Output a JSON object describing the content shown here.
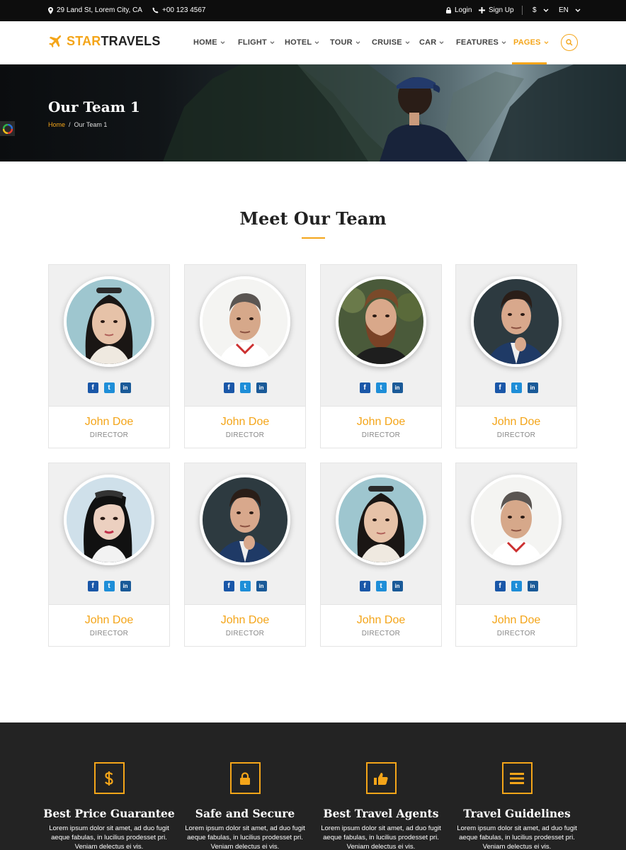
{
  "topbar": {
    "address": "29 Land St, Lorem City, CA",
    "phone": "+00 123 4567",
    "login": "Login",
    "signup": "Sign Up",
    "currency": "$",
    "language": "EN"
  },
  "brand": {
    "part1": "STAR",
    "part2": "TRAVELS",
    "accent": "#f4a519"
  },
  "nav": [
    "HOME",
    "FLIGHT",
    "HOTEL",
    "TOUR",
    "CRUISE",
    "CAR",
    "FEATURES",
    "PAGES"
  ],
  "nav_active": "PAGES",
  "hero": {
    "title": "Our Team 1",
    "breadcrumb_home": "Home",
    "breadcrumb_sep": "/",
    "breadcrumb_current": "Our Team 1"
  },
  "section": {
    "title": "Meet Our Team"
  },
  "team": [
    {
      "name": "John Doe",
      "role": "DIRECTOR"
    },
    {
      "name": "John Doe",
      "role": "DIRECTOR"
    },
    {
      "name": "John Doe",
      "role": "DIRECTOR"
    },
    {
      "name": "John Doe",
      "role": "DIRECTOR"
    },
    {
      "name": "John Doe",
      "role": "DIRECTOR"
    },
    {
      "name": "John Doe",
      "role": "DIRECTOR"
    },
    {
      "name": "John Doe",
      "role": "DIRECTOR"
    },
    {
      "name": "John Doe",
      "role": "DIRECTOR"
    }
  ],
  "social_icons": [
    "facebook-icon",
    "twitter-icon",
    "linkedin-icon"
  ],
  "features": [
    {
      "icon": "dollar-icon",
      "title": "Best Price Guarantee",
      "desc": "Lorem ipsum dolor sit amet, ad duo fugit aeque fabulas, in lucilius prodesset pri. Veniam delectus ei vis."
    },
    {
      "icon": "lock-icon",
      "title": "Safe and Secure",
      "desc": "Lorem ipsum dolor sit amet, ad duo fugit aeque fabulas, in lucilius prodesset pri. Veniam delectus ei vis."
    },
    {
      "icon": "thumbs-up-icon",
      "title": "Best Travel Agents",
      "desc": "Lorem ipsum dolor sit amet, ad duo fugit aeque fabulas, in lucilius prodesset pri. Veniam delectus ei vis."
    },
    {
      "icon": "list-icon",
      "title": "Travel Guidelines",
      "desc": "Lorem ipsum dolor sit amet, ad duo fugit aeque fabulas, in lucilius prodesset pri. Veniam delectus ei vis."
    }
  ]
}
